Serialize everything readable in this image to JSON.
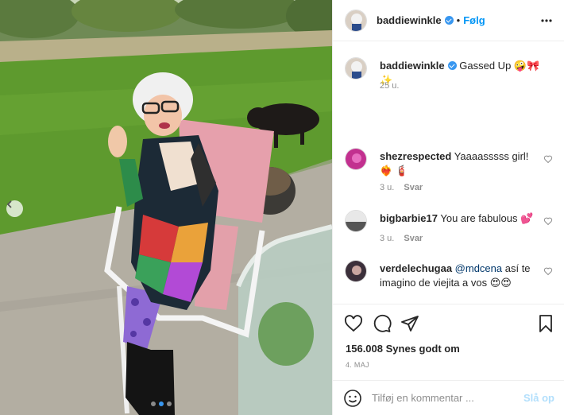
{
  "post": {
    "username": "baddiewinkle",
    "follow_label": "Følg",
    "separator": "•"
  },
  "caption": {
    "username": "baddiewinkle",
    "text": "Gassed Up 🤪🎀✨",
    "time": "25 u."
  },
  "comments": [
    {
      "username": "shezrespected",
      "text": "Yaaaasssss girl! ❤️‍🔥 🧯",
      "time": "3 u.",
      "reply_label": "Svar"
    },
    {
      "username": "bigbarbie17",
      "text": "You are fabulous 💕",
      "time": "3 u.",
      "reply_label": "Svar"
    },
    {
      "username": "verdelechugaa",
      "mention": "@mdcena",
      "text": " así te imagino de viejita a vos 😍😍",
      "time": "",
      "reply_label": ""
    }
  ],
  "stats": {
    "likes": "156.008 Synes godt om",
    "date": "4. maj"
  },
  "add_comment": {
    "placeholder": "Tilføj en kommentar ...",
    "post_label": "Slå op"
  },
  "carousel": {
    "total": 3,
    "active": 1
  },
  "colors": {
    "accent": "#0095f6",
    "verified": "#3897f0",
    "muted": "#8e8e8e"
  }
}
